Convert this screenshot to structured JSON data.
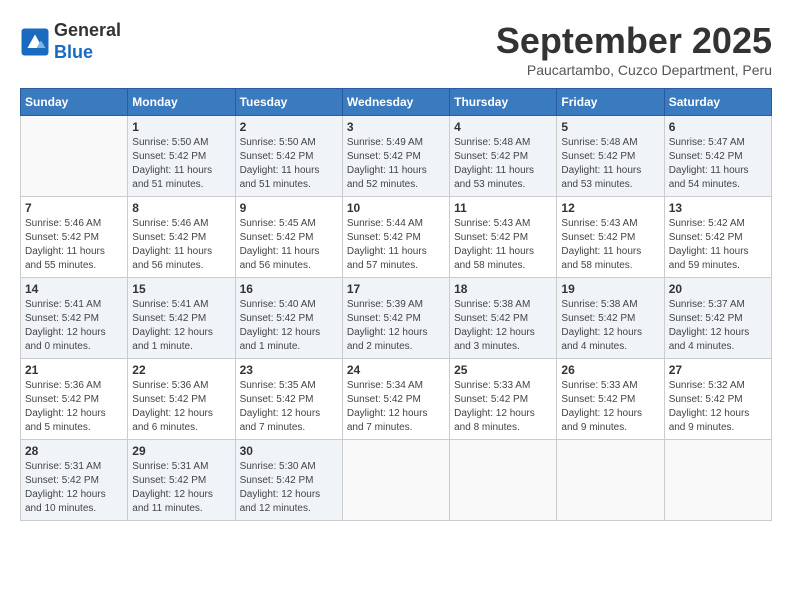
{
  "header": {
    "logo": {
      "general": "General",
      "blue": "Blue"
    },
    "title": "September 2025",
    "subtitle": "Paucartambo, Cuzco Department, Peru"
  },
  "calendar": {
    "days_of_week": [
      "Sunday",
      "Monday",
      "Tuesday",
      "Wednesday",
      "Thursday",
      "Friday",
      "Saturday"
    ],
    "weeks": [
      [
        {
          "day": "",
          "info": ""
        },
        {
          "day": "1",
          "info": "Sunrise: 5:50 AM\nSunset: 5:42 PM\nDaylight: 11 hours\nand 51 minutes."
        },
        {
          "day": "2",
          "info": "Sunrise: 5:50 AM\nSunset: 5:42 PM\nDaylight: 11 hours\nand 51 minutes."
        },
        {
          "day": "3",
          "info": "Sunrise: 5:49 AM\nSunset: 5:42 PM\nDaylight: 11 hours\nand 52 minutes."
        },
        {
          "day": "4",
          "info": "Sunrise: 5:48 AM\nSunset: 5:42 PM\nDaylight: 11 hours\nand 53 minutes."
        },
        {
          "day": "5",
          "info": "Sunrise: 5:48 AM\nSunset: 5:42 PM\nDaylight: 11 hours\nand 53 minutes."
        },
        {
          "day": "6",
          "info": "Sunrise: 5:47 AM\nSunset: 5:42 PM\nDaylight: 11 hours\nand 54 minutes."
        }
      ],
      [
        {
          "day": "7",
          "info": "Sunrise: 5:46 AM\nSunset: 5:42 PM\nDaylight: 11 hours\nand 55 minutes."
        },
        {
          "day": "8",
          "info": "Sunrise: 5:46 AM\nSunset: 5:42 PM\nDaylight: 11 hours\nand 56 minutes."
        },
        {
          "day": "9",
          "info": "Sunrise: 5:45 AM\nSunset: 5:42 PM\nDaylight: 11 hours\nand 56 minutes."
        },
        {
          "day": "10",
          "info": "Sunrise: 5:44 AM\nSunset: 5:42 PM\nDaylight: 11 hours\nand 57 minutes."
        },
        {
          "day": "11",
          "info": "Sunrise: 5:43 AM\nSunset: 5:42 PM\nDaylight: 11 hours\nand 58 minutes."
        },
        {
          "day": "12",
          "info": "Sunrise: 5:43 AM\nSunset: 5:42 PM\nDaylight: 11 hours\nand 58 minutes."
        },
        {
          "day": "13",
          "info": "Sunrise: 5:42 AM\nSunset: 5:42 PM\nDaylight: 11 hours\nand 59 minutes."
        }
      ],
      [
        {
          "day": "14",
          "info": "Sunrise: 5:41 AM\nSunset: 5:42 PM\nDaylight: 12 hours\nand 0 minutes."
        },
        {
          "day": "15",
          "info": "Sunrise: 5:41 AM\nSunset: 5:42 PM\nDaylight: 12 hours\nand 1 minute."
        },
        {
          "day": "16",
          "info": "Sunrise: 5:40 AM\nSunset: 5:42 PM\nDaylight: 12 hours\nand 1 minute."
        },
        {
          "day": "17",
          "info": "Sunrise: 5:39 AM\nSunset: 5:42 PM\nDaylight: 12 hours\nand 2 minutes."
        },
        {
          "day": "18",
          "info": "Sunrise: 5:38 AM\nSunset: 5:42 PM\nDaylight: 12 hours\nand 3 minutes."
        },
        {
          "day": "19",
          "info": "Sunrise: 5:38 AM\nSunset: 5:42 PM\nDaylight: 12 hours\nand 4 minutes."
        },
        {
          "day": "20",
          "info": "Sunrise: 5:37 AM\nSunset: 5:42 PM\nDaylight: 12 hours\nand 4 minutes."
        }
      ],
      [
        {
          "day": "21",
          "info": "Sunrise: 5:36 AM\nSunset: 5:42 PM\nDaylight: 12 hours\nand 5 minutes."
        },
        {
          "day": "22",
          "info": "Sunrise: 5:36 AM\nSunset: 5:42 PM\nDaylight: 12 hours\nand 6 minutes."
        },
        {
          "day": "23",
          "info": "Sunrise: 5:35 AM\nSunset: 5:42 PM\nDaylight: 12 hours\nand 7 minutes."
        },
        {
          "day": "24",
          "info": "Sunrise: 5:34 AM\nSunset: 5:42 PM\nDaylight: 12 hours\nand 7 minutes."
        },
        {
          "day": "25",
          "info": "Sunrise: 5:33 AM\nSunset: 5:42 PM\nDaylight: 12 hours\nand 8 minutes."
        },
        {
          "day": "26",
          "info": "Sunrise: 5:33 AM\nSunset: 5:42 PM\nDaylight: 12 hours\nand 9 minutes."
        },
        {
          "day": "27",
          "info": "Sunrise: 5:32 AM\nSunset: 5:42 PM\nDaylight: 12 hours\nand 9 minutes."
        }
      ],
      [
        {
          "day": "28",
          "info": "Sunrise: 5:31 AM\nSunset: 5:42 PM\nDaylight: 12 hours\nand 10 minutes."
        },
        {
          "day": "29",
          "info": "Sunrise: 5:31 AM\nSunset: 5:42 PM\nDaylight: 12 hours\nand 11 minutes."
        },
        {
          "day": "30",
          "info": "Sunrise: 5:30 AM\nSunset: 5:42 PM\nDaylight: 12 hours\nand 12 minutes."
        },
        {
          "day": "",
          "info": ""
        },
        {
          "day": "",
          "info": ""
        },
        {
          "day": "",
          "info": ""
        },
        {
          "day": "",
          "info": ""
        }
      ]
    ]
  }
}
